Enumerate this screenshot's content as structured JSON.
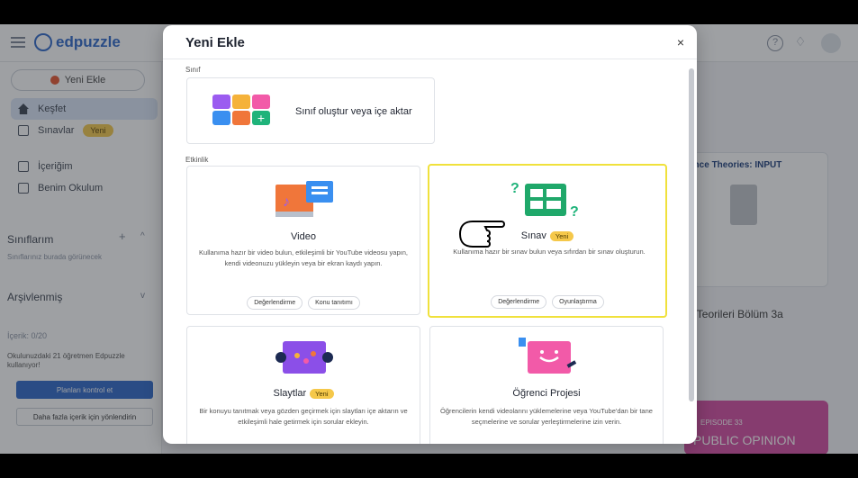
{
  "app": {
    "logo_text": "edpuzzle",
    "new_button": "Yeni Ekle",
    "nav": [
      {
        "label": "Keşfet"
      },
      {
        "label": "Sınavlar",
        "badge": "Yeni"
      },
      {
        "label": "İçeriğim"
      },
      {
        "label": "Benim Okulum"
      }
    ],
    "classes_heading": "Sınıflarım",
    "classes_empty": "Sınıflarınız burada görünecek",
    "archived_heading": "Arşivlenmiş",
    "content_count": "İçerik: 0/20",
    "school_note": "Okulunuzdaki 21 öğretmen Edpuzzle kullanıyor!",
    "plans_button": "Planları kontrol et",
    "more_content_button": "Daha fazla içerik için yönlendirin",
    "bg_card_title": "ence Theories: INPUT",
    "bg_card_caption": "e Teorileri Bölüm 3a",
    "bg_episode": "EPISODE 33",
    "bg_episode_title": "PUBLIC OPINION"
  },
  "modal": {
    "title": "Yeni Ekle",
    "close_label": "×",
    "section_class": "Sınıf",
    "class_option": "Sınıf oluştur veya içe aktar",
    "section_activity": "Etkinlik",
    "cards": {
      "video": {
        "title": "Video",
        "description": "Kullanıma hazır bir video bulun, etkileşimli bir YouTube videosu yapın, kendi videonuzu yükleyin veya bir ekran kaydı yapın.",
        "tags": [
          "Değerlendirme",
          "Konu tanıtımı"
        ]
      },
      "quiz": {
        "title": "Sınav",
        "badge": "Yeni",
        "description": "Kullanıma hazır bir sınav bulun veya sıfırdan bir sınav oluşturun.",
        "tags": [
          "Değerlendirme",
          "Oyunlaştırma"
        ]
      },
      "slides": {
        "title": "Slaytlar",
        "badge": "Yeni",
        "description": "Bir konuyu tanıtmak veya gözden geçirmek için slaytları içe aktarın ve etkileşimli hale getirmek için sorular ekleyin."
      },
      "project": {
        "title": "Öğrenci Projesi",
        "description": "Öğrencilerin kendi videolarını yüklemelerine veya YouTube'dan bir tane seçmelerine ve sorular yerleştirmelerine izin verin."
      }
    }
  },
  "colors": {
    "brand_blue": "#2c66c8",
    "highlight_yellow": "#f0e13c",
    "badge_yellow": "#f5c84a"
  }
}
